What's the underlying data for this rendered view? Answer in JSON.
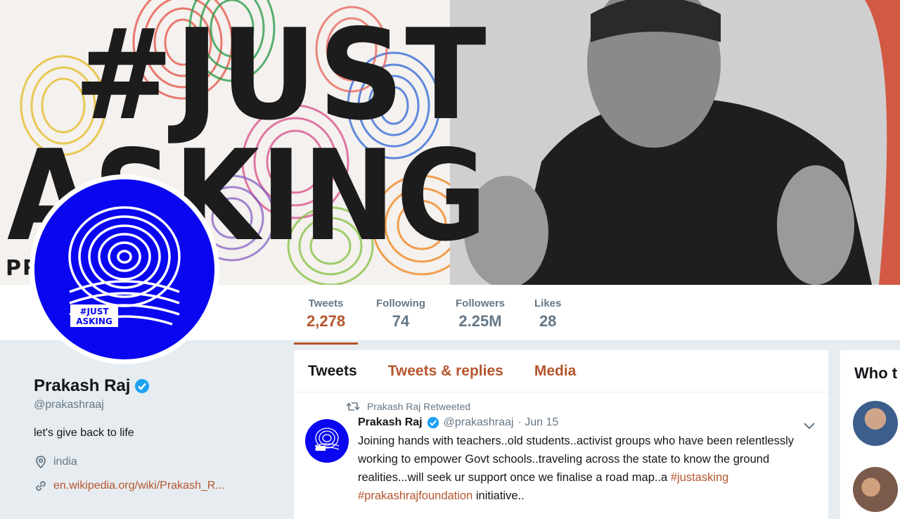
{
  "banner": {
    "hashtag_line1": "#JUST",
    "hashtag_line2": "ASKING",
    "corner_text": "PR"
  },
  "avatar": {
    "text_line1": "#JUST",
    "text_line2": "ASKING"
  },
  "stats": [
    {
      "label": "Tweets",
      "value": "2,278",
      "active": true
    },
    {
      "label": "Following",
      "value": "74"
    },
    {
      "label": "Followers",
      "value": "2.25M"
    },
    {
      "label": "Likes",
      "value": "28"
    }
  ],
  "profile": {
    "name": "Prakash Raj",
    "handle": "@prakashraaj",
    "bio": "let's give back to life",
    "location": "india",
    "website": "en.wikipedia.org/wiki/Prakash_R..."
  },
  "timeline": {
    "tabs": [
      "Tweets",
      "Tweets & replies",
      "Media"
    ],
    "active_tab": "Tweets"
  },
  "tweet": {
    "retweet_label": "Prakash Raj Retweeted",
    "author_name": "Prakash Raj",
    "author_handle": "@prakashraaj",
    "date": "· Jun 15",
    "text_main": "Joining hands with teachers..old students..activist groups who have been relentlessly working to empower Govt schools..traveling across the state to know the ground realities...will seek ur support once we finalise a road map..a",
    "tag1": "#justasking",
    "tag2": "#prakashrajfoundation",
    "text_end": "initiative.."
  },
  "who_to_follow": {
    "title": "Who t"
  },
  "colors": {
    "accent": "#b5552c",
    "verified": "#1da1f2",
    "avatar_blue": "#0a06f0",
    "muted": "#657786"
  }
}
